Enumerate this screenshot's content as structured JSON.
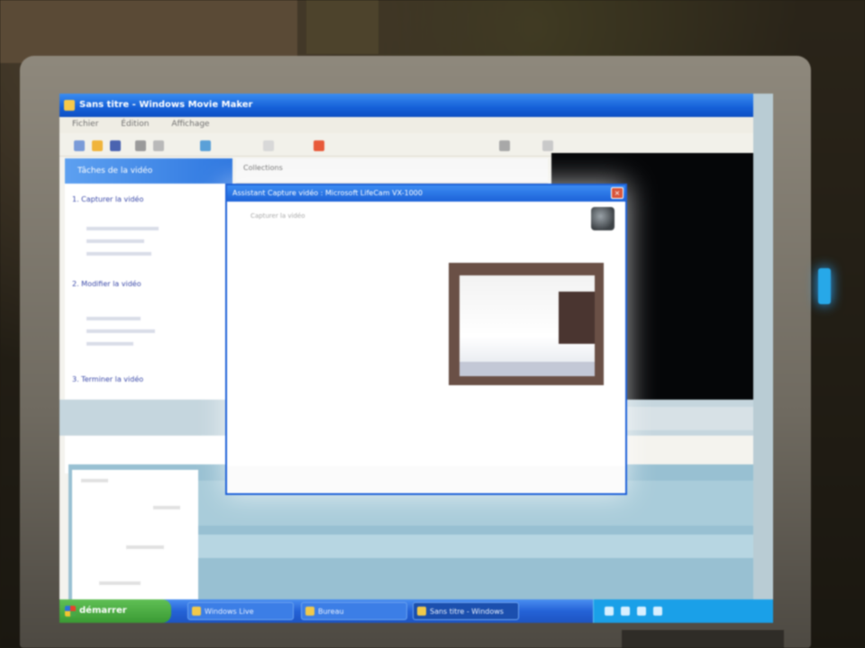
{
  "main_window": {
    "title": "Sans titre - Windows Movie Maker",
    "menu": [
      "Fichier",
      "Édition",
      "Affichage"
    ]
  },
  "tasks_pane": {
    "header": "Tâches de la vidéo",
    "sections": [
      {
        "label": "1. Capturer la vidéo"
      },
      {
        "label": "2. Modifier la vidéo"
      },
      {
        "label": "3. Terminer la vidéo"
      }
    ]
  },
  "collection": {
    "label": "Collections"
  },
  "capture_dialog": {
    "title": "Assistant Capture vidéo : Microsoft LifeCam VX-1000",
    "subtitle": "Capturer la vidéo",
    "close_label": "×"
  },
  "taskbar": {
    "start_label": "démarrer",
    "buttons": [
      {
        "label": "Windows Live"
      },
      {
        "label": "Bureau"
      },
      {
        "label": "Sans titre - Windows"
      }
    ],
    "clock": ""
  },
  "colors": {
    "titlebar_blue": "#1560d8",
    "taskbar_blue": "#2462d6",
    "start_green": "#3a9a34",
    "storyboard_blue": "#98c0d2",
    "preview_black": "#050608"
  }
}
